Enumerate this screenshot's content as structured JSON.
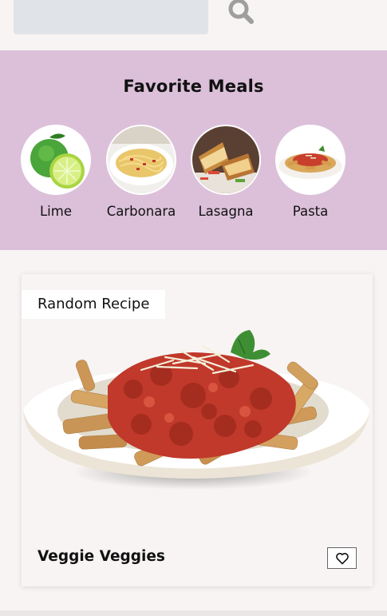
{
  "search": {
    "value": "",
    "placeholder": ""
  },
  "favorites": {
    "title": "Favorite Meals",
    "items": [
      {
        "label": "Lime"
      },
      {
        "label": "Carbonara"
      },
      {
        "label": "Lasagna"
      },
      {
        "label": "Pasta"
      }
    ]
  },
  "random_card": {
    "tag": "Random Recipe",
    "title": "Veggie Veggies",
    "heart_icon": "heart-outline-icon"
  },
  "colors": {
    "favorites_bg": "#dcc0da",
    "page_bg": "#f7f4f3",
    "search_bg": "#e0e4e8",
    "search_icon": "#9e9e9e"
  }
}
